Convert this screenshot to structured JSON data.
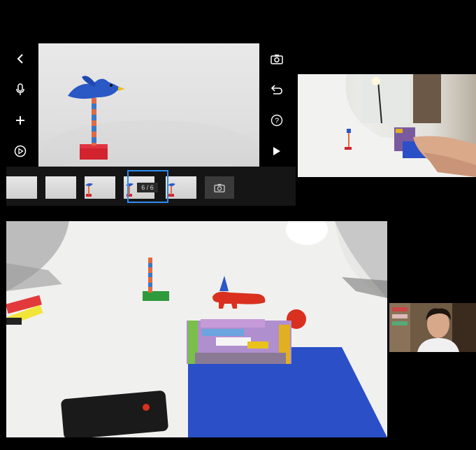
{
  "toolbar_left": {
    "back": "back-icon",
    "mic": "microphone-icon",
    "add": "plus-icon",
    "settings": "playback-settings-icon"
  },
  "toolbar_right": {
    "camera": "camera-icon",
    "undo": "undo-icon",
    "help": "help-icon",
    "play": "play-icon"
  },
  "timeline": {
    "frame_counter": "6 / 6"
  },
  "colors": {
    "selection": "#2e8cf0",
    "background": "#000000",
    "lego_blue": "#2a4fc7",
    "clay_red": "#d9301f"
  }
}
